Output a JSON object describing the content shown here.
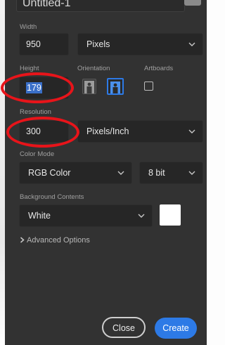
{
  "document": {
    "name": "Untitled-1"
  },
  "width": {
    "label": "Width",
    "value": "950",
    "unit": "Pixels"
  },
  "height": {
    "label": "Height",
    "value": "179"
  },
  "orientation": {
    "label": "Orientation",
    "portrait_icon": "portrait-icon",
    "landscape_icon": "landscape-icon",
    "selected": "landscape"
  },
  "artboards": {
    "label": "Artboards",
    "checked": false
  },
  "resolution": {
    "label": "Resolution",
    "value": "300",
    "unit": "Pixels/Inch"
  },
  "color_mode": {
    "label": "Color Mode",
    "mode": "RGB Color",
    "depth": "8 bit"
  },
  "background": {
    "label": "Background Contents",
    "value": "White",
    "swatch_color": "#ffffff"
  },
  "advanced": {
    "label": "Advanced Options"
  },
  "actions": {
    "close": "Close",
    "create": "Create"
  },
  "colors": {
    "panel": "#323232",
    "field": "#262626",
    "accent": "#2d7ae6",
    "annotation": "#e8141a"
  }
}
